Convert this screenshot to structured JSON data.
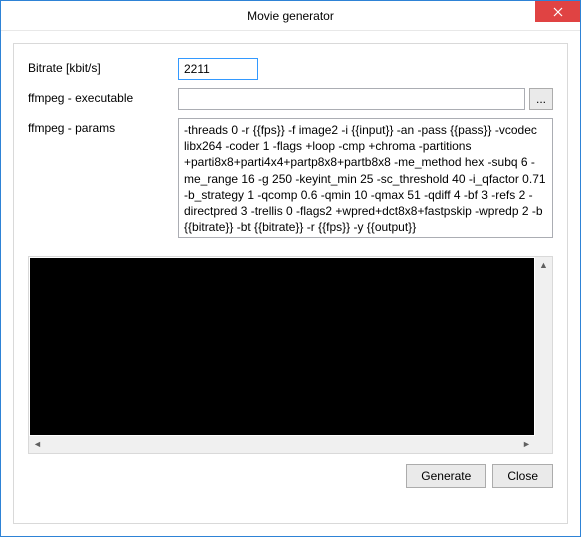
{
  "window": {
    "title": "Movie generator"
  },
  "form": {
    "bitrate_label": "Bitrate [kbit/s]",
    "bitrate_value": "2211",
    "exec_label": "ffmpeg - executable",
    "exec_value": "",
    "browse_label": "...",
    "params_label": "ffmpeg - params",
    "params_value": "-threads 0 -r {{fps}} -f image2 -i {{input}} -an -pass {{pass}} -vcodec libx264 -coder 1 -flags +loop -cmp +chroma -partitions +parti8x8+parti4x4+partp8x8+partb8x8 -me_method hex -subq 6 -me_range 16 -g 250 -keyint_min 25 -sc_threshold 40 -i_qfactor 0.71 -b_strategy 1 -qcomp 0.6 -qmin 10 -qmax 51 -qdiff 4 -bf 3 -refs 2 -directpred 3 -trellis 0 -flags2 +wpred+dct8x8+fastpskip -wpredp 2 -b {{bitrate}} -bt {{bitrate}} -r {{fps}} -y {{output}}"
  },
  "buttons": {
    "generate": "Generate",
    "close": "Close"
  }
}
